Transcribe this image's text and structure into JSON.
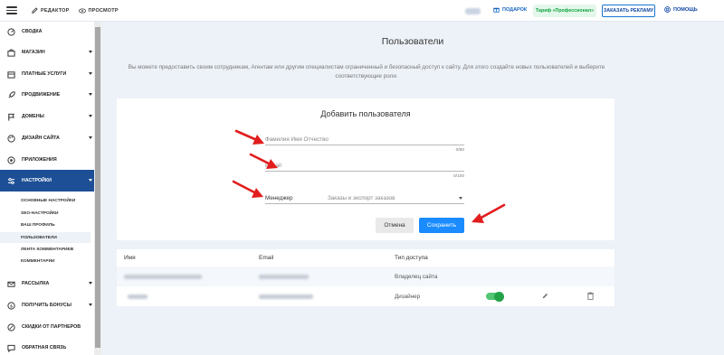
{
  "topbar": {
    "editor_label": "РЕДАКТОР",
    "preview_label": "ПРОСМОТР",
    "gift_label": "ПОДАРОК",
    "tariff_label": "Тариф «Профессионал»",
    "ad_button_label": "ЗАКАЗАТЬ РЕКЛАМУ",
    "help_label": "ПОМОЩЬ"
  },
  "sidebar": {
    "items": [
      {
        "label": "СВОДКА",
        "icon": "gauge-icon"
      },
      {
        "label": "МАГАЗИН",
        "icon": "shop-icon"
      },
      {
        "label": "ПЛАТНЫЕ УСЛУГИ",
        "icon": "paid-services-icon"
      },
      {
        "label": "ПРОДВИЖЕНИЕ",
        "icon": "rocket-icon"
      },
      {
        "label": "ДОМЕНЫ",
        "icon": "flag-icon"
      },
      {
        "label": "ДИЗАЙН САЙТА",
        "icon": "palette-icon"
      },
      {
        "label": "ПРИЛОЖЕНИЯ",
        "icon": "apps-icon"
      },
      {
        "label": "НАСТРОЙКИ",
        "icon": "settings-icon"
      },
      {
        "label": "РАССЫЛКА",
        "icon": "mail-icon"
      },
      {
        "label": "ПОЛУЧИТЬ БОНУСЫ",
        "icon": "coin-icon"
      },
      {
        "label": "СКИДКИ ОТ ПАРТНЕРОВ",
        "icon": "discount-icon"
      },
      {
        "label": "ОБРАТНАЯ СВЯЗЬ",
        "icon": "chat-icon"
      }
    ],
    "submenu": [
      "ОСНОВНЫЕ НАСТРОЙКИ",
      "SEO-НАСТРОЙКИ",
      "ВАШ ПРОФИЛЬ",
      "ПОЛЬЗОВАТЕЛИ",
      "ЛЕНТА КОММЕНТАРИЕВ",
      "КОММЕНТАРИИ"
    ]
  },
  "main": {
    "title": "Пользователи",
    "intro": "Вы можете предоставить своим сотрудникам, Агентам или другим специалистам ограниченный и безопасный доступ к сайту. Для этого создайте новых пользователей и выберите соответствующие роли."
  },
  "form": {
    "title": "Добавить пользователя",
    "name_placeholder": "Фамилия Имя Отчество",
    "name_counter": "0/60",
    "email_placeholder": "E-mail",
    "email_counter": "0/100",
    "role_label": "Менеджер",
    "role_value": "Заказы и экспорт заказов",
    "cancel_label": "Отмена",
    "save_label": "Сохранить"
  },
  "table": {
    "headers": [
      "Имя",
      "Email",
      "Тип доступа"
    ],
    "rows": [
      {
        "access": "Владелец сайта",
        "toggle_on": false
      },
      {
        "access": "Дизайнер",
        "toggle_on": true
      }
    ]
  },
  "colors": {
    "accent": "#1a8cff",
    "sidebar_active": "#1d4f96",
    "tariff_green": "#11a341",
    "annotation_red": "#e21d1d"
  }
}
